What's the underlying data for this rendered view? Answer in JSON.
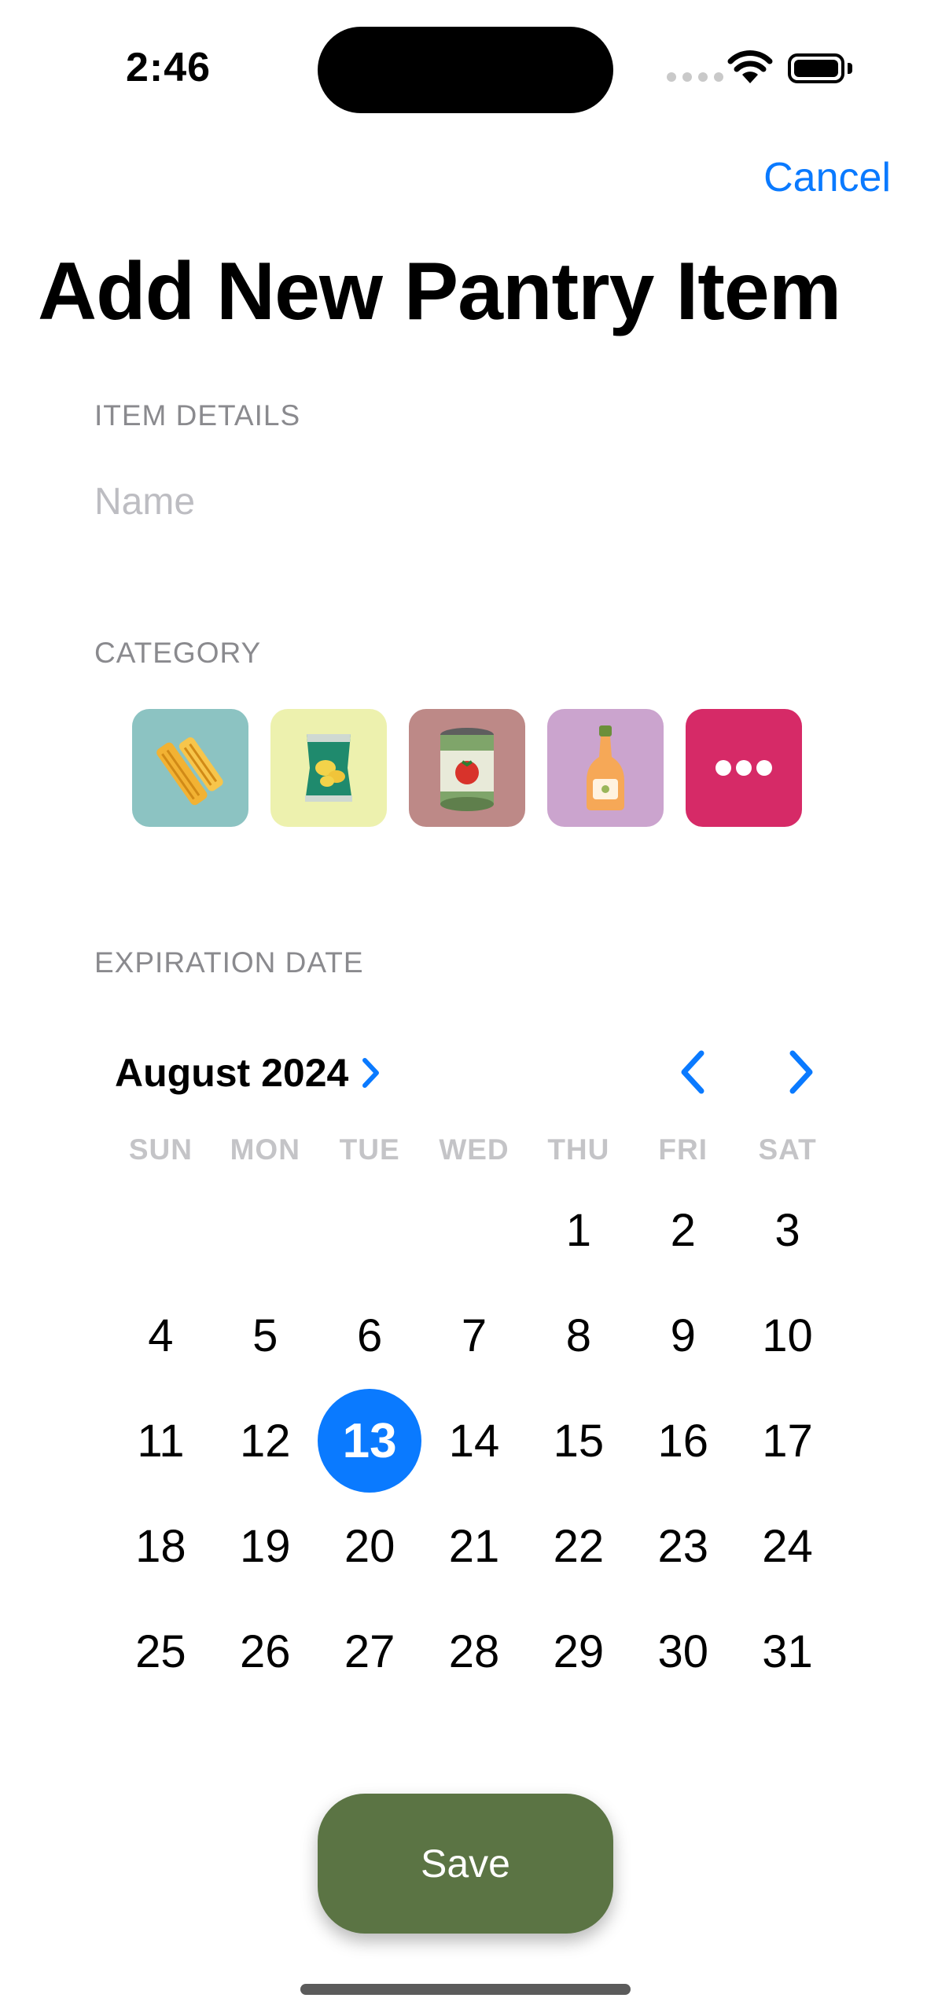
{
  "status_bar": {
    "time": "2:46"
  },
  "header": {
    "cancel_label": "Cancel",
    "title": "Add New Pantry Item"
  },
  "item_details": {
    "section_label": "ITEM DETAILS",
    "name_placeholder": "Name",
    "name_value": ""
  },
  "category": {
    "section_label": "CATEGORY",
    "items": [
      {
        "icon": "pasta-icon",
        "color": "#8cc3c2"
      },
      {
        "icon": "chips-bag-icon",
        "color": "#edf1ae"
      },
      {
        "icon": "canned-tomato-icon",
        "color": "#bd8987"
      },
      {
        "icon": "sauce-bottle-icon",
        "color": "#cba4ce"
      },
      {
        "icon": "more-icon",
        "color": "#d62a67"
      }
    ]
  },
  "expiration": {
    "section_label": "EXPIRATION DATE",
    "month_label": "August 2024",
    "weekdays": [
      "SUN",
      "MON",
      "TUE",
      "WED",
      "THU",
      "FRI",
      "SAT"
    ],
    "leading_blanks": 4,
    "days_in_month": 31,
    "selected_day": 13,
    "accent_color": "#0a7aff"
  },
  "save_label": "Save"
}
